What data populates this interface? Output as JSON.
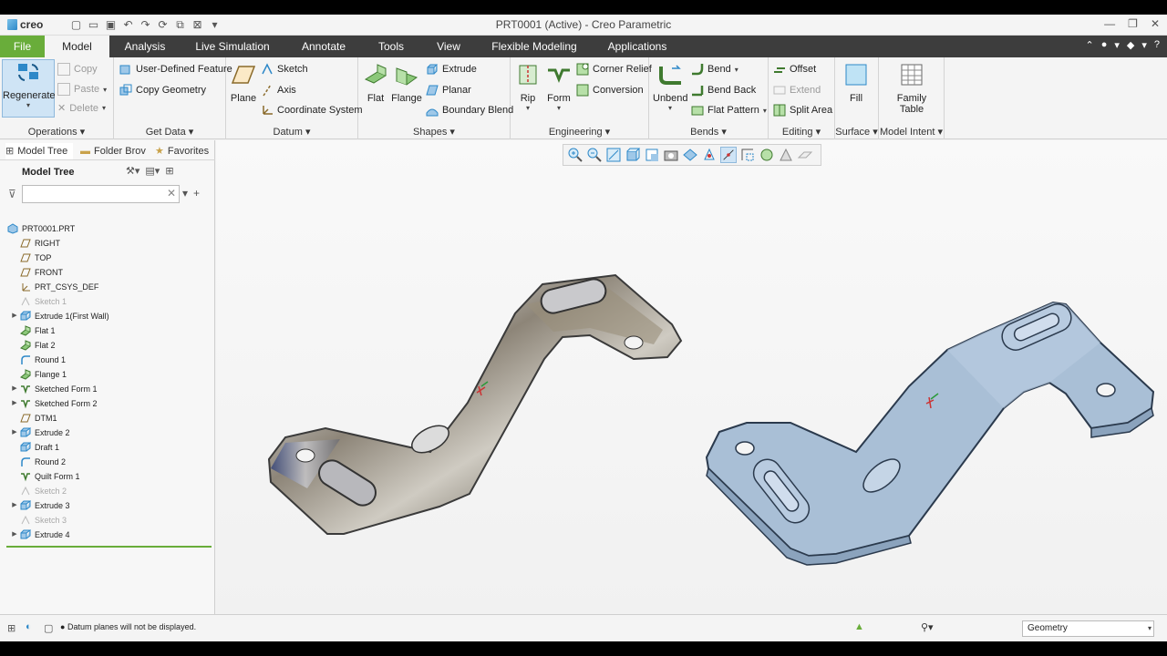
{
  "app": {
    "logo_text": "creo",
    "window_title": "PRT0001 (Active) - Creo Parametric"
  },
  "tabs": [
    "File",
    "Model",
    "Analysis",
    "Live Simulation",
    "Annotate",
    "Tools",
    "View",
    "Flexible Modeling",
    "Applications"
  ],
  "ribbon": {
    "operations": {
      "label": "Operations",
      "regenerate": "Regenerate",
      "copy": "Copy",
      "paste": "Paste",
      "delete": "Delete"
    },
    "get_data": {
      "label": "Get Data",
      "udf": "User-Defined Feature",
      "copy_geometry": "Copy Geometry"
    },
    "datum": {
      "label": "Datum",
      "plane": "Plane",
      "sketch": "Sketch",
      "axis": "Axis",
      "csys": "Coordinate System"
    },
    "shapes": {
      "label": "Shapes",
      "flat": "Flat",
      "flange": "Flange",
      "extrude": "Extrude",
      "planar": "Planar",
      "boundary_blend": "Boundary Blend"
    },
    "engineering": {
      "label": "Engineering",
      "rip": "Rip",
      "form": "Form",
      "corner_relief": "Corner Relief",
      "conversion": "Conversion"
    },
    "bends": {
      "label": "Bends",
      "unbend": "Unbend",
      "bend": "Bend",
      "bend_back": "Bend Back",
      "flat_pattern": "Flat Pattern"
    },
    "editing": {
      "label": "Editing",
      "offset": "Offset",
      "extend": "Extend",
      "split_area": "Split Area"
    },
    "surface": {
      "label": "Surface",
      "fill": "Fill"
    },
    "model_intent": {
      "label": "Model Intent",
      "family_table_1": "Family",
      "family_table_2": "Table"
    }
  },
  "panel": {
    "tabs": [
      "Model Tree",
      "Folder Brov",
      "Favorites"
    ],
    "title": "Model Tree",
    "search_placeholder": "",
    "tree": [
      {
        "label": "PRT0001.PRT",
        "icon": "part",
        "dim": false,
        "exp": false,
        "lvl": 0
      },
      {
        "label": "RIGHT",
        "icon": "plane",
        "dim": false,
        "exp": false,
        "lvl": 1
      },
      {
        "label": "TOP",
        "icon": "plane",
        "dim": false,
        "exp": false,
        "lvl": 1
      },
      {
        "label": "FRONT",
        "icon": "plane",
        "dim": false,
        "exp": false,
        "lvl": 1
      },
      {
        "label": "PRT_CSYS_DEF",
        "icon": "csys",
        "dim": false,
        "exp": false,
        "lvl": 1
      },
      {
        "label": "Sketch 1",
        "icon": "sketch",
        "dim": true,
        "exp": false,
        "lvl": 1
      },
      {
        "label": "Extrude 1(First Wall)",
        "icon": "extrude",
        "dim": false,
        "exp": true,
        "lvl": 1
      },
      {
        "label": "Flat 1",
        "icon": "flat",
        "dim": false,
        "exp": false,
        "lvl": 1
      },
      {
        "label": "Flat 2",
        "icon": "flat",
        "dim": false,
        "exp": false,
        "lvl": 1
      },
      {
        "label": "Round 1",
        "icon": "round",
        "dim": false,
        "exp": false,
        "lvl": 1
      },
      {
        "label": "Flange 1",
        "icon": "flat",
        "dim": false,
        "exp": false,
        "lvl": 1
      },
      {
        "label": "Sketched Form 1",
        "icon": "form",
        "dim": false,
        "exp": true,
        "lvl": 1
      },
      {
        "label": "Sketched Form 2",
        "icon": "form",
        "dim": false,
        "exp": true,
        "lvl": 1
      },
      {
        "label": "DTM1",
        "icon": "plane",
        "dim": false,
        "exp": false,
        "lvl": 1
      },
      {
        "label": "Extrude 2",
        "icon": "extrude",
        "dim": false,
        "exp": true,
        "lvl": 1
      },
      {
        "label": "Draft 1",
        "icon": "extrude",
        "dim": false,
        "exp": false,
        "lvl": 1
      },
      {
        "label": "Round 2",
        "icon": "round",
        "dim": false,
        "exp": false,
        "lvl": 1
      },
      {
        "label": "Quilt Form 1",
        "icon": "form",
        "dim": false,
        "exp": false,
        "lvl": 1
      },
      {
        "label": "Sketch 2",
        "icon": "sketch",
        "dim": true,
        "exp": false,
        "lvl": 1
      },
      {
        "label": "Extrude 3",
        "icon": "extrude",
        "dim": false,
        "exp": true,
        "lvl": 1
      },
      {
        "label": "Sketch 3",
        "icon": "sketch",
        "dim": true,
        "exp": false,
        "lvl": 1
      },
      {
        "label": "Extrude 4",
        "icon": "extrude",
        "dim": false,
        "exp": true,
        "lvl": 1
      }
    ]
  },
  "status": {
    "message": "Datum planes will not be displayed.",
    "filter_value": "Geometry"
  },
  "colors": {
    "file_tab": "#69ad3a",
    "tab_bar": "#3d3d3d",
    "accent_blue": "#2d88c8",
    "part_blue": "#a9bfd6"
  }
}
